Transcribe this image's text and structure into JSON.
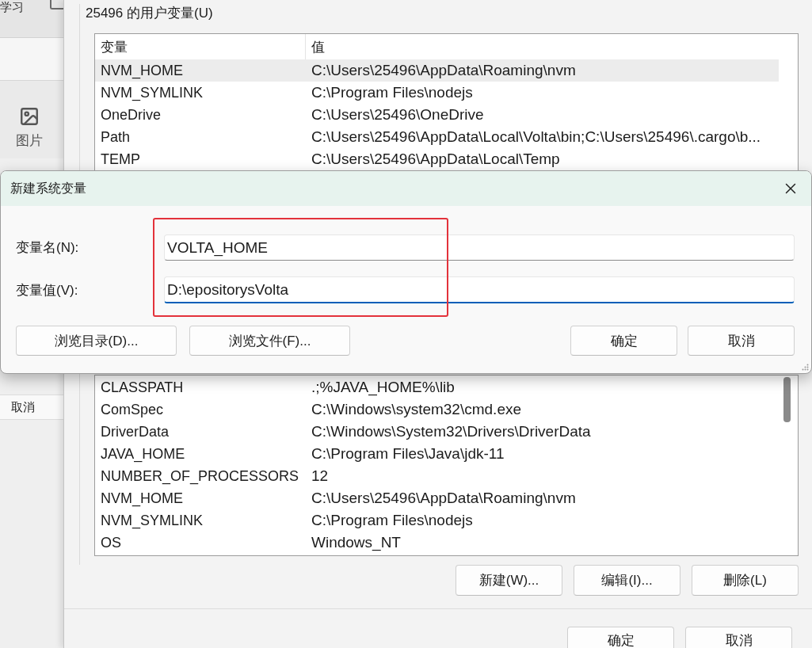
{
  "background_window": {
    "tab_label": "学习",
    "media_label": "图片",
    "cancel_button": "取消"
  },
  "user_variables": {
    "title": "25496 的用户变量(U)",
    "columns": [
      "变量",
      "值"
    ],
    "rows": [
      {
        "name": "NVM_HOME",
        "value": "C:\\Users\\25496\\AppData\\Roaming\\nvm",
        "selected": true
      },
      {
        "name": "NVM_SYMLINK",
        "value": "C:\\Program Files\\nodejs",
        "selected": false
      },
      {
        "name": "OneDrive",
        "value": "C:\\Users\\25496\\OneDrive",
        "selected": false
      },
      {
        "name": "Path",
        "value": "C:\\Users\\25496\\AppData\\Local\\Volta\\bin;C:\\Users\\25496\\.cargo\\b...",
        "selected": false
      },
      {
        "name": "TEMP",
        "value": "C:\\Users\\25496\\AppData\\Local\\Temp",
        "selected": false
      }
    ]
  },
  "new_variable_dialog": {
    "title": "新建系统变量",
    "fields": [
      {
        "label": "变量名(N):",
        "value": "VOLTA_HOME",
        "focused": false
      },
      {
        "label": "变量值(V):",
        "value": "D:\\epositorysVolta",
        "focused": true
      }
    ],
    "left_buttons": [
      "浏览目录(D)...",
      "浏览文件(F)..."
    ],
    "right_buttons": [
      "确定",
      "取消"
    ],
    "annotations": [
      {
        "kind": "rectangle"
      }
    ]
  },
  "system_variables": {
    "rows": [
      {
        "name": "CLASSPATH",
        "value": ".;%JAVA_HOME%\\lib",
        "selected": false
      },
      {
        "name": "ComSpec",
        "value": "C:\\Windows\\system32\\cmd.exe",
        "selected": false
      },
      {
        "name": "DriverData",
        "value": "C:\\Windows\\System32\\Drivers\\DriverData",
        "selected": false
      },
      {
        "name": "JAVA_HOME",
        "value": "C:\\Program Files\\Java\\jdk-11",
        "selected": false
      },
      {
        "name": "NUMBER_OF_PROCESSORS",
        "value": "12",
        "selected": false
      },
      {
        "name": "NVM_HOME",
        "value": "C:\\Users\\25496\\AppData\\Roaming\\nvm",
        "selected": false
      },
      {
        "name": "NVM_SYMLINK",
        "value": "C:\\Program Files\\nodejs",
        "selected": false
      },
      {
        "name": "OS",
        "value": "Windows_NT",
        "selected": false
      }
    ]
  },
  "system_buttons": [
    "新建(W)...",
    "编辑(I)...",
    "删除(L)"
  ],
  "footer_buttons": [
    "确定",
    "取消"
  ]
}
